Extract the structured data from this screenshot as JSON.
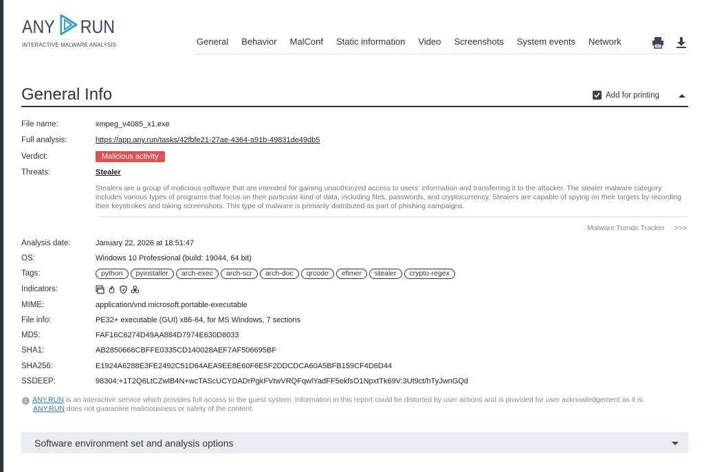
{
  "logo": {
    "left_text": "ANY",
    "right_text": "RUN",
    "tagline": "INTERACTIVE MALWARE ANALYSIS"
  },
  "nav": {
    "items": [
      "General",
      "Behavior",
      "MalConf",
      "Static information",
      "Video",
      "Screenshots",
      "System events",
      "Network"
    ],
    "icons": [
      "print-icon",
      "download-icon"
    ]
  },
  "general": {
    "title": "General Info",
    "print_label": "Add for printing",
    "print_checked": true
  },
  "fields": {
    "file_name": {
      "label": "File name:",
      "value": "xmpeg_v4085_x1.exe"
    },
    "full_analysis": {
      "label": "Full analysis:",
      "value": "https://app.any.run/tasks/42fbfe21-27ae-4364-a91b-49831de49db5"
    },
    "verdict": {
      "label": "Verdict:",
      "value": "Malicious activity",
      "color": "#e05252"
    },
    "threats": {
      "label": "Threats:",
      "value": "Stealer"
    },
    "threat_description": "Stealers are a group of malicious software that are intended for gaining unauthorized access to users' information and transferring it to the attacker. The stealer malware category includes various types of programs that focus on their particular kind of data, including files, passwords, and cryptocurrency. Stealers are capable of spying on their targets by recording their keystrokes and taking screenshots. This type of malware is primarily distributed as part of phishing campaigns.",
    "tracker": {
      "label": "Malware Trends Tracker",
      "arrows": ">>>"
    },
    "analysis_date": {
      "label": "Analysis date:",
      "value": "January 22, 2026 at 18:51:47"
    },
    "os": {
      "label": "OS:",
      "value": "Windows 10 Professional (build: 19044, 64 bit)"
    },
    "tags": {
      "label": "Tags:",
      "values": [
        "python",
        "pyinstaller",
        "arch-exec",
        "arch-scr",
        "arch-doc",
        "qrcode",
        "efimer",
        "stealer",
        "crypto-regex"
      ]
    },
    "indicators": {
      "label": "Indicators:",
      "icons": [
        "executable-icon",
        "fire-icon",
        "shield-icon",
        "biohazard-icon"
      ]
    },
    "mime": {
      "label": "MIME:",
      "value": "application/vnd.microsoft.portable-executable"
    },
    "file_info": {
      "label": "File info:",
      "value": "PE32+ executable (GUI) x86-64, for MS Windows, 7 sections"
    },
    "md5": {
      "label": "MD5:",
      "value": "FAF16C6274D49AA884D7974E630D8033"
    },
    "sha1": {
      "label": "SHA1:",
      "value": "AB2850666CBFFE0335CD140028AEF7AF506695BF"
    },
    "sha256": {
      "label": "SHA256:",
      "value": "E1924A6288E3FE2492C51D64AEA9EE8E60F6E5F2DDCDCA60A5BFB159CF4D6D44"
    },
    "ssdeep": {
      "label": "SSDEEP:",
      "value": "98304:+1T2Q6LtCZwlB4N+wcTAScUCYDADrPgkFVtwVRQFqwlYadFF5ekfsO1NpxtTk69V:3Ut9ct/hTyJwnGQd"
    }
  },
  "notice": {
    "brand": "ANY.RUN",
    "text1": " is an interactive service which provides full access to the guest system. Information in this report could be distorted by user actions and is provided for user acknowledgement as it is.",
    "text2": " does not guarantee maliciousness or safety of the content."
  },
  "accordion": {
    "title": "Software environment set and analysis options"
  },
  "colors": {
    "accent": "#3a4657",
    "verdict": "#e05252",
    "brand_link": "#2d7bc4",
    "left_bar": "#2d3340"
  }
}
